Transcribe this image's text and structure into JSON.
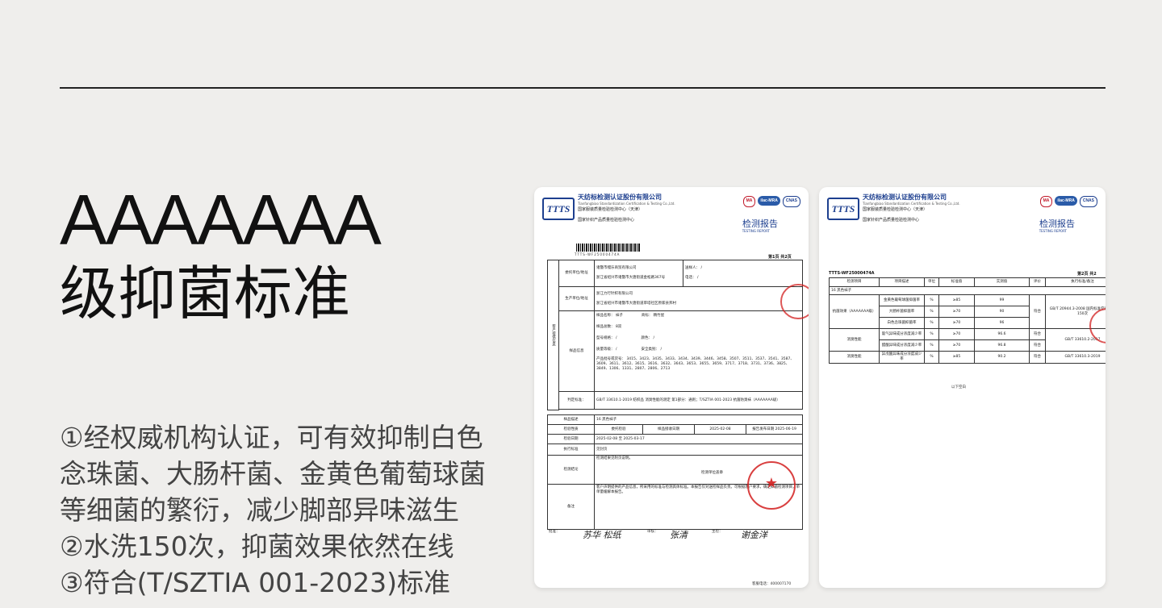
{
  "headline": {
    "line1": "AAAAAAA",
    "line2": "级抑菌标准"
  },
  "bullets": [
    "①经权威机构认证，可有效抑制白色",
    "念珠菌、大肠杆菌、金黄色葡萄球菌",
    "等细菌的繁衍，减少脚部异味滋生",
    "②水洗150次，抑菌效果依然在线",
    "③符合(T/SZTIA 001-2023)标准"
  ],
  "report": {
    "logo": "TTTS",
    "org_name": "天纺标检测认证股份有限公司",
    "org_en": "Tianfangbiao Standardization Certification & Testing Co.,Ltd.",
    "org_line2": "国家服装质量检验检测中心（天津）",
    "org_line3": "国家针织产品质量检验检测中心",
    "badge_ma": "MA",
    "badge_ilac": "ilac-MRA",
    "badge_cnas": "CNAS",
    "title": "检测报告",
    "title_en": "TESTING REPORT"
  },
  "page1": {
    "barcode_no": "TTTS-WF25000474A",
    "page_no": "第1页 共2页",
    "client_label": "委托单位/地址",
    "client_name": "诸暨市缦乐商贸有限公司",
    "client_addr": "浙江省绍兴市诸暨市大唐街道金松路367号",
    "contact_label": "送样人：",
    "contact_val": "/",
    "phone_label": "电话：",
    "phone_val": "/",
    "maker_label": "生产单位/地址",
    "maker_name": "浙江力行针织有限公司",
    "maker_addr": "浙江省绍兴市诸暨市大唐街道草塔社区原家县邦村",
    "sample_info_label": "样品信息",
    "sample_name_label": "样品名称：",
    "sample_name": "袜子",
    "brand_label": "商标：",
    "brand": "精竹屋",
    "sample_qty_label": "样品总数：",
    "sample_qty": "8双",
    "model_label": "型号规格：",
    "model": "/",
    "color_label": "颜色：",
    "color": "/",
    "grade_label": "质量等级：",
    "grade": "/",
    "safety_label": "安全类别：",
    "safety": "/",
    "batch_label": "产品批号或货号：",
    "batch": "3415、3423、3435、3433、3434、3439、3446、3458、3507、3511、3537、3541、3587、3609、3611、3612、3615、3616、3632、3643、3653、3655、3659、3717、3718、3731、3736、3825、3849、1306、1331、2807、2806、2713",
    "standard_label": "判定标准：",
    "standard": "GB/T 33610.1-2019 纺织品 消臭性能的测定 第1部分：通则；T/SZTIA 001-2023 抗菌防臭袜（AAAAAAA级）",
    "desc_label": "样品描述",
    "desc": "16 黑色袜子",
    "inspect_label": "检验性质",
    "inspect": "委托检验",
    "recv_label": "样品接收日期",
    "recv": "2025-02-08",
    "issue_label": "报告发布日期",
    "issue": "2025-06-19",
    "test_date_label": "检验日期",
    "test_date_from": "2025-02-08",
    "test_date_to": "2025-03-17",
    "exec_label": "执行标准",
    "exec": "见封页",
    "conclusion_label": "检测结论",
    "conclusion": "检测结果见附页说明。",
    "stamp_text": "检测单位盖章",
    "remark_label": "备注",
    "remark": "客户声明提供的产品信息，所采用的标准与检测具体标准。本报告仅对送检样品负责。可根据客户要求，确定抑菌检测项目，单单量缓解本报告。",
    "approve_label": "批准：",
    "review_label": "审核：",
    "writer_label": "主检：",
    "footer": "客服电话：400007170"
  },
  "page2": {
    "report_no": "TTTS-WF25000474A",
    "page_no": "第2页 共2",
    "headers": [
      "检测项目",
      "项目描述",
      "单位",
      "标准值",
      "实测值",
      "评价",
      "执行标准/备注"
    ],
    "sample_row": "16 黑色袜子",
    "rows": [
      {
        "item": "抗菌效果（AAAAAAA级）",
        "desc": "金黄色葡萄球菌抑菌率",
        "unit": "%",
        "std": "≥85",
        "val": "99",
        "eval": "符合",
        "note": "GB/T 20944.3-2008 国内标准空白洗涤150次"
      },
      {
        "item": "",
        "desc": "大肠杆菌抑菌率",
        "unit": "%",
        "std": "≥70",
        "val": "90",
        "eval": "",
        "note": ""
      },
      {
        "item": "",
        "desc": "白色念珠菌抑菌率",
        "unit": "%",
        "std": "≥70",
        "val": "96",
        "eval": "",
        "note": ""
      },
      {
        "item": "消臭性能",
        "desc": "氨气异味成分浓度减少率",
        "unit": "%",
        "std": "≥70",
        "val": "96.6",
        "eval": "符合",
        "note": "GB/T 33610.2-2017"
      },
      {
        "item": "",
        "desc": "醋酸异味成分浓度减少率",
        "unit": "%",
        "std": "≥70",
        "val": "96.8",
        "eval": "符合",
        "note": ""
      },
      {
        "item": "消臭性能",
        "desc": "异戊酸异味成分浓度减少率",
        "unit": "%",
        "std": "≥85",
        "val": "90.2",
        "eval": "符合",
        "note": "GB/T 33610.3-2019"
      }
    ],
    "blank": "以下空白"
  }
}
